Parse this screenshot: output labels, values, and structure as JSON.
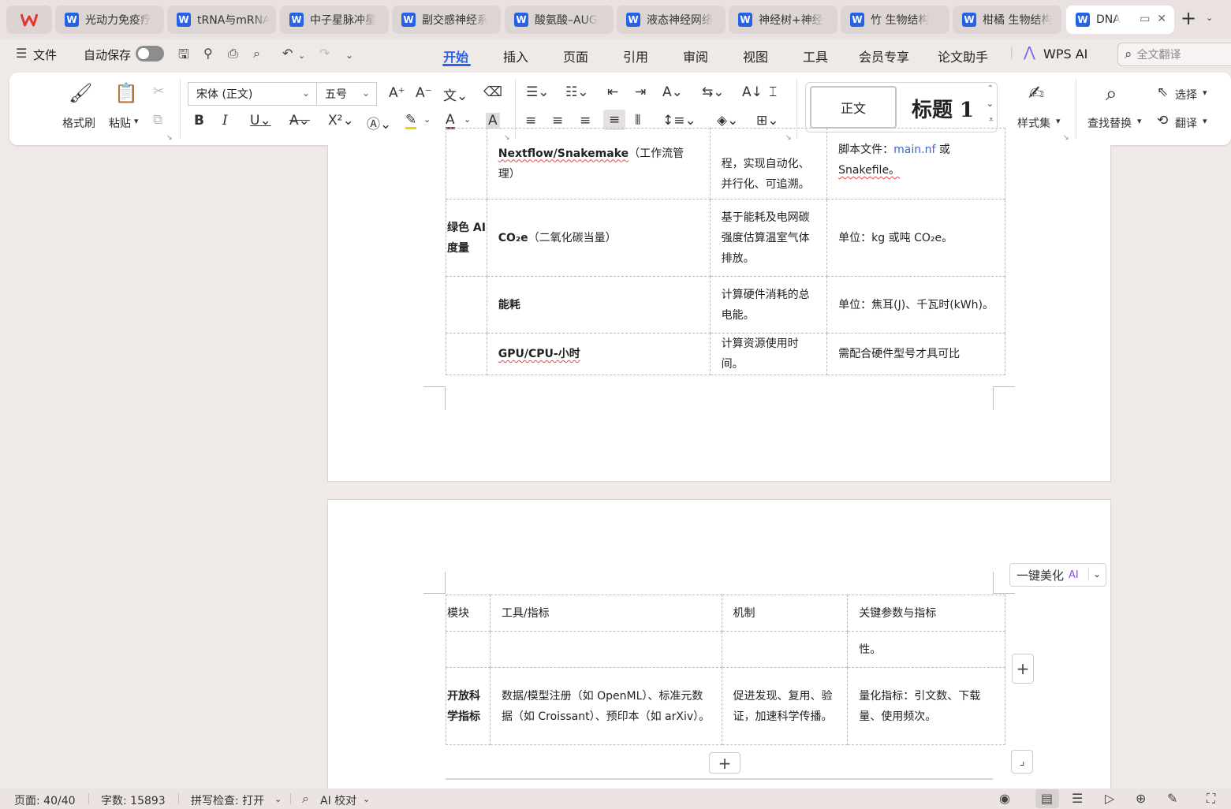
{
  "tabs": [
    {
      "label": "光动力免疫疗",
      "active": false
    },
    {
      "label": "tRNA与mRNA",
      "active": false
    },
    {
      "label": "中子星脉冲星",
      "active": false
    },
    {
      "label": "副交感神经系",
      "active": false
    },
    {
      "label": "酸氨酸–AUG",
      "active": false
    },
    {
      "label": "液态神经网络",
      "active": false
    },
    {
      "label": "神经树+神经",
      "active": false
    },
    {
      "label": "竹 生物结构",
      "active": false
    },
    {
      "label": "柑橘 生物结构",
      "active": false
    },
    {
      "label": "DNA",
      "active": true
    }
  ],
  "menubar": {
    "file": "文件",
    "autosave": "自动保存",
    "items": [
      "开始",
      "插入",
      "页面",
      "引用",
      "审阅",
      "视图",
      "工具",
      "会员专享",
      "论文助手"
    ],
    "wps_ai": "WPS AI",
    "search_placeholder": "全文翻译"
  },
  "ribbon": {
    "format_painter": "格式刷",
    "paste": "粘贴",
    "font_name": "宋体 (正文)",
    "font_size": "五号",
    "style_normal": "正文",
    "style_heading": "标题  1",
    "style_set": "样式集",
    "find_replace": "查找替换",
    "select": "选择",
    "translate": "翻译"
  },
  "table1": {
    "rows": [
      {
        "module": "",
        "tool": "Nextflow/Snakemake",
        "tool_suffix": "（工作流管理）",
        "mech": "程，实现自动化、并行化、可追溯。",
        "param_prefix": "脚本文件：",
        "param_link": "main.nf",
        "param_mid": " 或 ",
        "param_tail": "Snakefile。"
      },
      {
        "module": "绿色 AI 度量",
        "tool": "CO₂e",
        "tool_suffix": "（二氧化碳当量）",
        "mech": "基于能耗及电网碳强度估算温室气体排放。",
        "param": "单位：kg 或吨 CO₂e。"
      },
      {
        "module": "",
        "tool": "能耗",
        "tool_suffix": "",
        "mech": "计算硬件消耗的总电能。",
        "param": "单位：焦耳(J)、千瓦时(kWh)。"
      },
      {
        "module": "",
        "tool": "GPU/CPU-小时",
        "tool_suffix": "",
        "mech": "计算资源使用时间。",
        "param": "需配合硬件型号才具可比"
      }
    ]
  },
  "table2": {
    "header": {
      "module": "模块",
      "tool": "工具/指标",
      "mech": "机制",
      "param": "关键参数与指标"
    },
    "cont_row": {
      "param": "性。"
    },
    "row": {
      "module": "开放科学指标",
      "tool": "数据/模型注册（如 OpenML）、标准元数据（如 Croissant）、预印本（如 arXiv）。",
      "mech": "促进发现、复用、验证，加速科学传播。",
      "param": "量化指标：引文数、下载量、使用频次。"
    }
  },
  "beautify": {
    "label": "一键美化",
    "ai": "AI"
  },
  "status": {
    "page": "页面: 40/40",
    "words": "字数: 15893",
    "spell": "拼写检查: 打开",
    "ai_check": "AI 校对"
  }
}
